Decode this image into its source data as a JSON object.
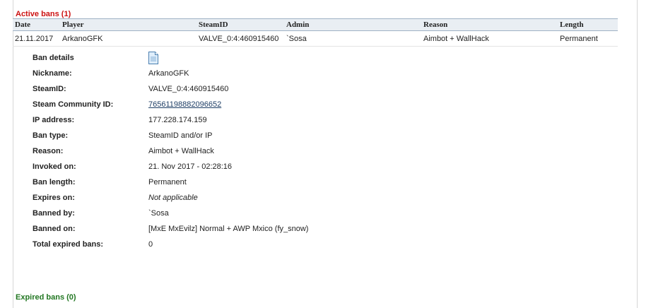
{
  "active_bans": {
    "title": "Active bans (1)",
    "columns": [
      "Date",
      "Player",
      "SteamID",
      "Admin",
      "Reason",
      "Length"
    ],
    "rows": [
      {
        "date": "21.11.2017",
        "player": "ArkanoGFK",
        "steamid": "VALVE_0:4:460915460",
        "admin": "`Sosa",
        "reason": "Aimbot + WallHack",
        "length": "Permanent"
      }
    ]
  },
  "ban_details": {
    "header_label": "Ban details",
    "header_icon": "document-icon",
    "fields": [
      {
        "label": "Nickname:",
        "value": "ArkanoGFK"
      },
      {
        "label": "SteamID:",
        "value": "VALVE_0:4:460915460"
      },
      {
        "label": "Steam Community ID:",
        "value": "76561198882096652"
      },
      {
        "label": "IP address:",
        "value": "177.228.174.159"
      },
      {
        "label": "Ban type:",
        "value": "SteamID and/or IP"
      },
      {
        "label": "Reason:",
        "value": "Aimbot + WallHack"
      },
      {
        "label": "Invoked on:",
        "value": "21. Nov 2017 - 02:28:16"
      },
      {
        "label": "Ban length:",
        "value": "Permanent"
      },
      {
        "label": "Expires on:",
        "value": "Not applicable"
      },
      {
        "label": "Banned by:",
        "value": "`Sosa"
      },
      {
        "label": "Banned on:",
        "value": "[MxE MxEvilz] Normal + AWP Mxico (fy_snow)"
      },
      {
        "label": "Total expired bans:",
        "value": "0"
      }
    ]
  },
  "expired_bans": {
    "title": "Expired bans (0)"
  },
  "colors": {
    "active_title": "#cc1111",
    "expired_title": "#227722",
    "table_header_bg": "#e9eef3",
    "link": "#1f3f66"
  }
}
